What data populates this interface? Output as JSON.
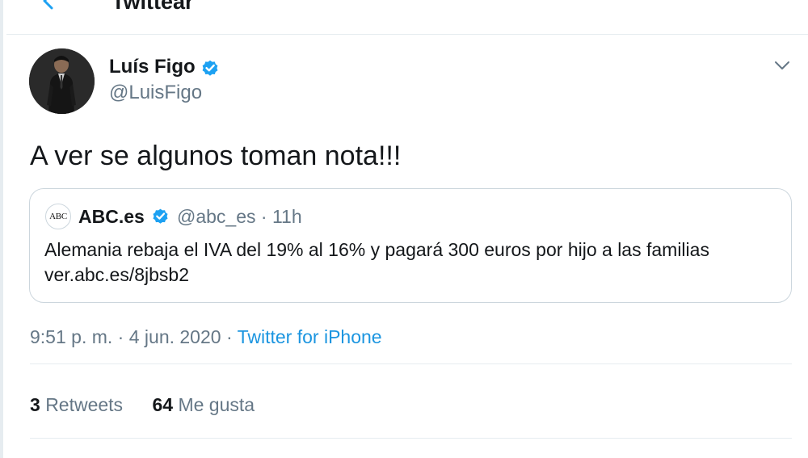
{
  "header": {
    "title": "Twittear",
    "back_icon": "arrow-left-icon"
  },
  "tweet": {
    "author": {
      "name": "Luís Figo",
      "handle": "@LuisFigo",
      "verified": true
    },
    "text": "A ver se algunos toman nota!!!",
    "quoted": {
      "name": "ABC.es",
      "avatar_text": "ABC",
      "verified": true,
      "handle": "@abc_es",
      "separator": "·",
      "time": "11h",
      "text_line1": "Alemania rebaja el IVA del 19% al 16% y pagará 300 euros por hijo a las familias",
      "text_line2": "ver.abc.es/8jbsb2"
    },
    "time": "9:51 p. m.",
    "separator": "·",
    "date": "4 jun. 2020",
    "source": "Twitter for iPhone",
    "stats": {
      "retweets_count": "3",
      "retweets_label": "Retweets",
      "likes_count": "64",
      "likes_label": "Me gusta"
    }
  },
  "colors": {
    "link": "#1b95e0",
    "verified": "#1da1f2",
    "secondary_text": "#657786",
    "border": "#e6ecf0"
  }
}
